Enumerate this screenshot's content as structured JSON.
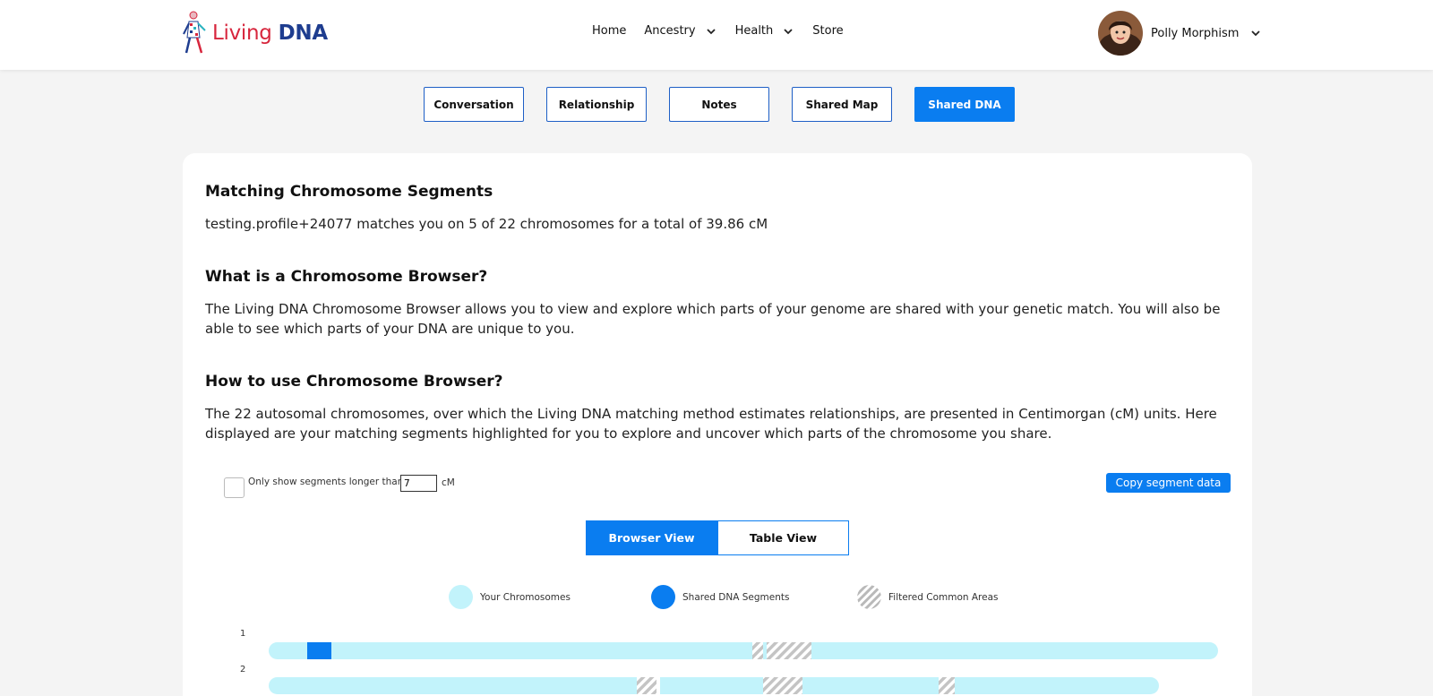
{
  "brand": {
    "word1": "Living",
    "word2": "DNA"
  },
  "nav": {
    "home": "Home",
    "ancestry": "Ancestry",
    "health": "Health",
    "store": "Store"
  },
  "user": {
    "name": "Polly Morphism"
  },
  "tabs": [
    "Conversation",
    "Relationship",
    "Notes",
    "Shared Map",
    "Shared DNA"
  ],
  "active_tab": "Shared DNA",
  "sections": {
    "matching_title": "Matching Chromosome Segments",
    "matching_text": "testing.profile+24077 matches you on 5 of 22 chromosomes for a total of 39.86 cM",
    "what_title": "What is a Chromosome Browser?",
    "what_text": "The Living DNA Chromosome Browser allows you to view and explore which parts of your genome are shared with your genetic match. You will also be able to see which parts of your DNA are unique to you.",
    "how_title": "How to use Chromosome Browser?",
    "how_text": "The 22 autosomal chromosomes, over which the Living DNA matching method estimates relationships, are presented in Centimorgan (cM) units. Here displayed are your matching segments highlighted for you to explore and uncover which parts of the chromosome you share."
  },
  "filter": {
    "label": "Only show segments longer than",
    "value": "7",
    "unit": "cM",
    "checked": false
  },
  "copy_button": "Copy segment data",
  "views": {
    "browser": "Browser View",
    "table": "Table View",
    "active": "Browser View"
  },
  "legend": {
    "yours": "Your Chromosomes",
    "shared": "Shared DNA Segments",
    "filtered": "Filtered Common Areas"
  },
  "colors": {
    "primary": "#0a7df0",
    "chromosome": "#c2f3fb",
    "shared": "#0a7df0",
    "filtered": "#b9b9b9"
  },
  "chromosomes": [
    {
      "label": "1"
    },
    {
      "label": "2"
    }
  ]
}
